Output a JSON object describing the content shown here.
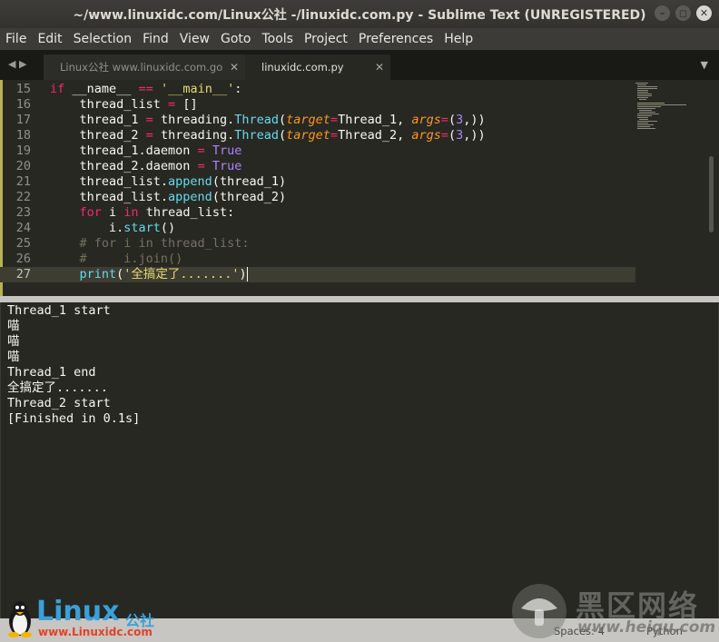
{
  "window": {
    "title": "~/www.linuxidc.com/Linux公社 -/linuxidc.com.py - Sublime Text (UNREGISTERED)",
    "minimize": "–",
    "maximize": "◻",
    "close": "✕"
  },
  "menu": [
    "File",
    "Edit",
    "Selection",
    "Find",
    "View",
    "Goto",
    "Tools",
    "Project",
    "Preferences",
    "Help"
  ],
  "tabs": [
    {
      "label": "Linux公社 www.linuxidc.com.go",
      "close": "✕",
      "active": false
    },
    {
      "label": "linuxidc.com.py",
      "close": "✕",
      "active": true
    }
  ],
  "tabbar": {
    "nav": "◀ ▶",
    "dropdown": "▼"
  },
  "editor": {
    "line_numbers": [
      "15",
      "16",
      "17",
      "18",
      "19",
      "20",
      "21",
      "22",
      "23",
      "24",
      "25",
      "26",
      "27"
    ],
    "current_line": "27"
  },
  "output": {
    "lines": [
      "Thread_1 start",
      "喵",
      "喵",
      "喵",
      "Thread_1 end",
      "全搞定了.......",
      "Thread_2 start",
      "[Finished in 0.1s]"
    ]
  },
  "status": {
    "spaces": "Spaces: 4",
    "syntax": "Python"
  },
  "watermarks": {
    "linux_brand": "Linux",
    "linux_cn": "公社",
    "linux_url": "www.Linuxidc.com",
    "heiqu_cn": "黑区网络",
    "heiqu_url": "www.heiqu.com"
  },
  "colors": {
    "background": "#272822",
    "keyword": "#f92672",
    "function": "#66d9ef",
    "string": "#e6db74",
    "argument": "#fd971f",
    "number": "#ae81ff",
    "comment": "#75715e"
  }
}
